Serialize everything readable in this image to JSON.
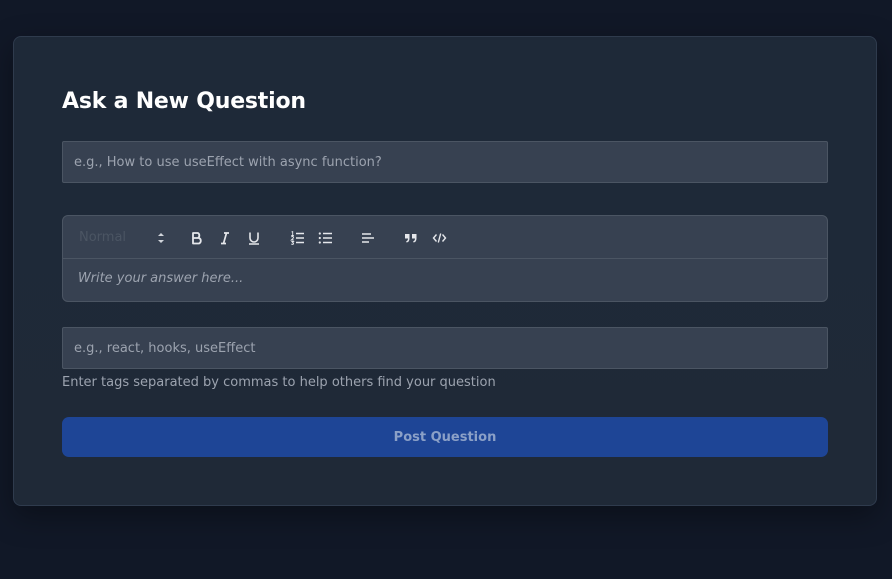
{
  "form": {
    "title": "Ask a New Question",
    "title_placeholder": "e.g., How to use useEffect with async function?",
    "editor": {
      "heading_select_value": "Normal",
      "placeholder": "Write your answer here...",
      "toolbar_icons": [
        "bold-icon",
        "italic-icon",
        "underline-icon",
        "ordered-list-icon",
        "bullet-list-icon",
        "align-left-icon",
        "blockquote-icon",
        "code-icon"
      ]
    },
    "tags_placeholder": "e.g., react, hooks, useEffect",
    "tags_hint": "Enter tags separated by commas to help others find your question",
    "submit_label": "Post Question"
  },
  "colors": {
    "background": "#111827",
    "card": "#1f2937",
    "input": "#374151",
    "accent": "#1e4596"
  }
}
